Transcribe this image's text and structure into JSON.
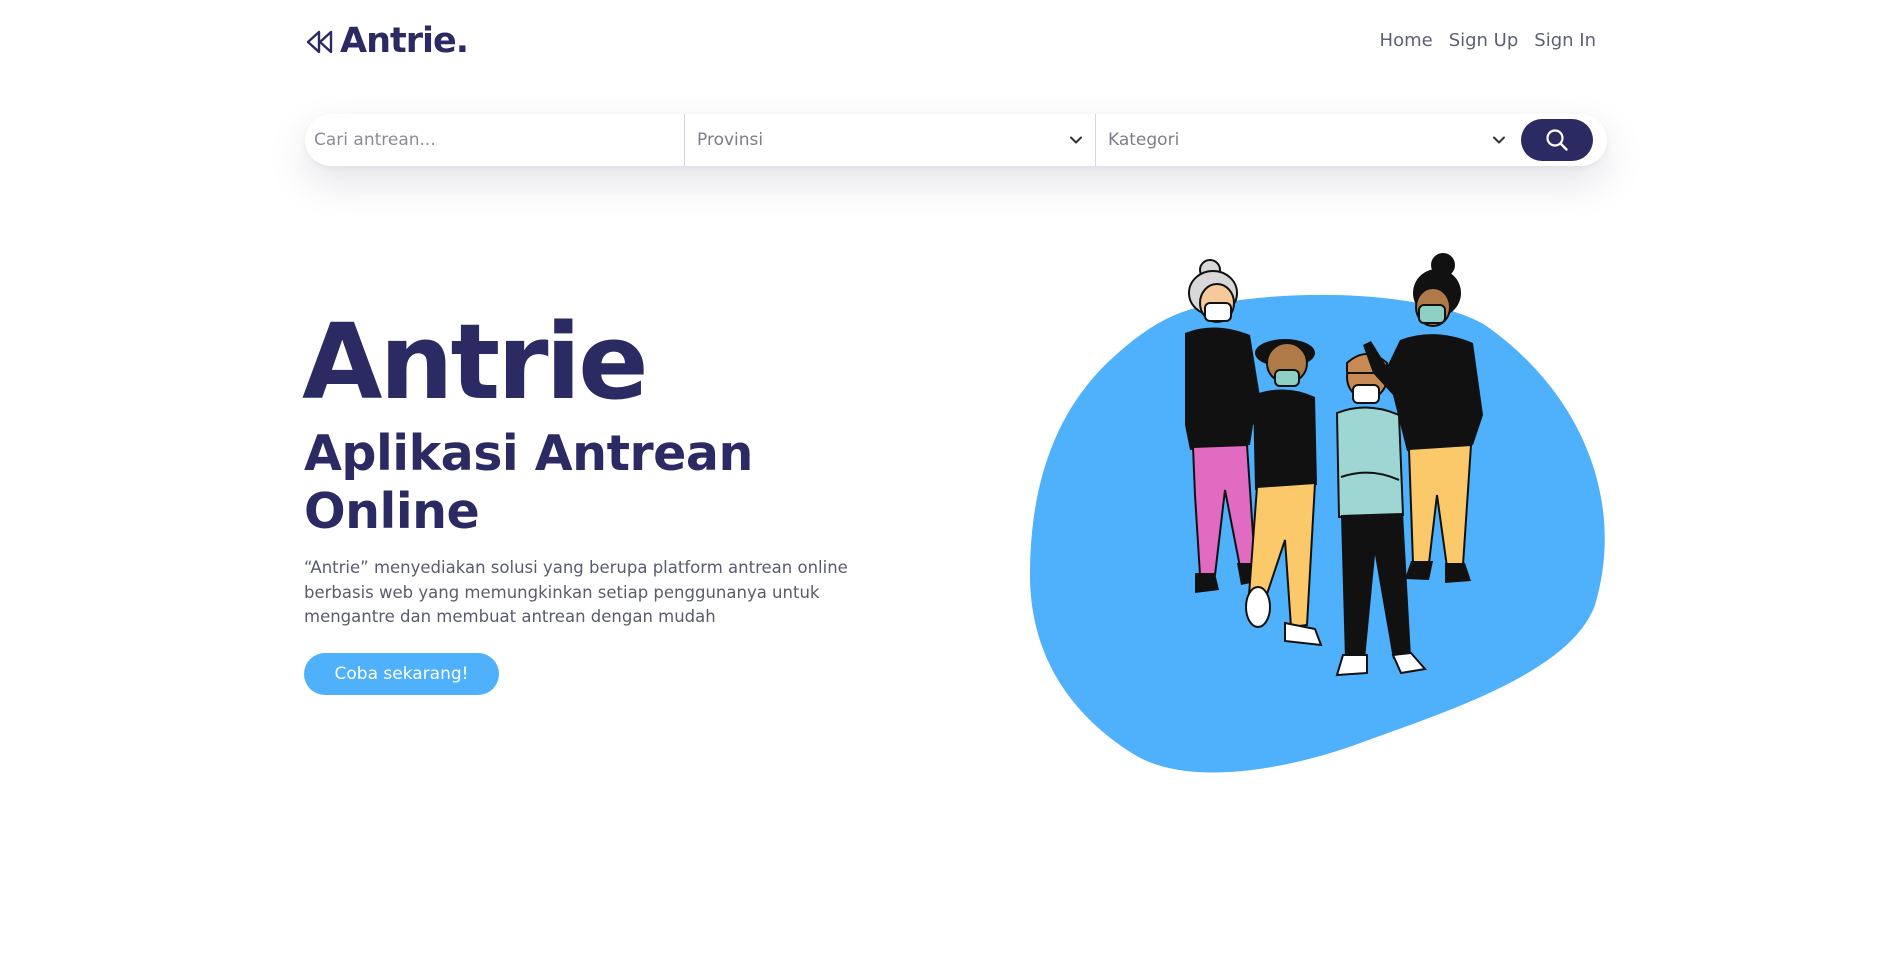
{
  "brand": {
    "name": "Antrie.",
    "icon": "rewind-icon"
  },
  "nav": {
    "home": "Home",
    "signup": "Sign Up",
    "signin": "Sign In"
  },
  "search": {
    "placeholder": "Cari antrean...",
    "province": "Provinsi",
    "category": "Kategori",
    "button_icon": "search-icon"
  },
  "hero": {
    "title": "Antrie",
    "subtitle": "Aplikasi Antrean Online",
    "description": "“Antrie” menyediakan solusi yang berupa platform antrean online berbasis web yang memungkinkan setiap penggunanya untuk mengantre dan membuat antrean dengan mudah",
    "cta": "Coba sekarang!"
  },
  "colors": {
    "primary": "#2b2a63",
    "accent": "#4fb0fb",
    "text_muted": "#5a5c6b"
  }
}
